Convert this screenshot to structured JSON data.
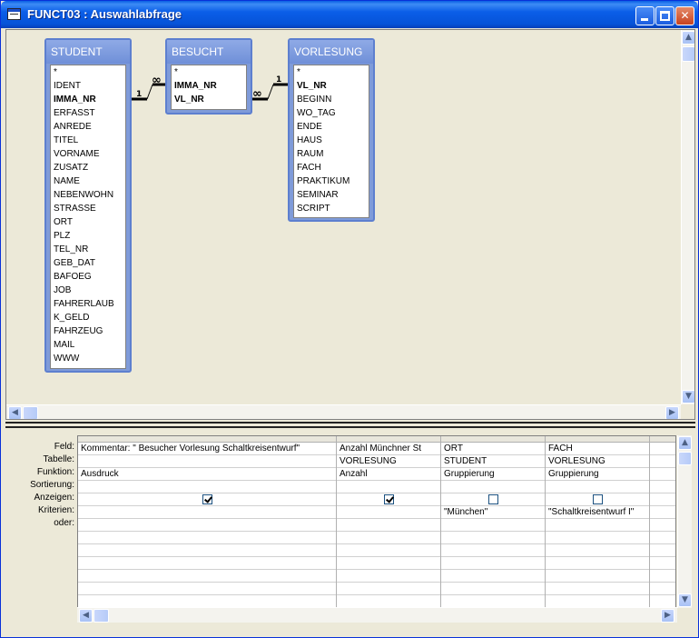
{
  "window": {
    "title": "FUNCT03 : Auswahlabfrage",
    "minimize_label": "",
    "maximize_label": "",
    "close_label": "✕"
  },
  "tables": [
    {
      "name": "STUDENT",
      "fields": [
        {
          "label": "*",
          "key": false
        },
        {
          "label": "IDENT",
          "key": false
        },
        {
          "label": "IMMA_NR",
          "key": true
        },
        {
          "label": "ERFASST",
          "key": false
        },
        {
          "label": "ANREDE",
          "key": false
        },
        {
          "label": "TITEL",
          "key": false
        },
        {
          "label": "VORNAME",
          "key": false
        },
        {
          "label": "ZUSATZ",
          "key": false
        },
        {
          "label": "NAME",
          "key": false
        },
        {
          "label": "NEBENWOHN",
          "key": false
        },
        {
          "label": "STRASSE",
          "key": false
        },
        {
          "label": "ORT",
          "key": false
        },
        {
          "label": "PLZ",
          "key": false
        },
        {
          "label": "TEL_NR",
          "key": false
        },
        {
          "label": "GEB_DAT",
          "key": false
        },
        {
          "label": "BAFOEG",
          "key": false
        },
        {
          "label": "JOB",
          "key": false
        },
        {
          "label": "FAHRERLAUB",
          "key": false
        },
        {
          "label": "K_GELD",
          "key": false
        },
        {
          "label": "FAHRZEUG",
          "key": false
        },
        {
          "label": "MAIL",
          "key": false
        },
        {
          "label": "WWW",
          "key": false
        }
      ]
    },
    {
      "name": "BESUCHT",
      "fields": [
        {
          "label": "*",
          "key": false
        },
        {
          "label": "IMMA_NR",
          "key": true
        },
        {
          "label": "VL_NR",
          "key": true
        }
      ]
    },
    {
      "name": "VORLESUNG",
      "fields": [
        {
          "label": "*",
          "key": false
        },
        {
          "label": "VL_NR",
          "key": true
        },
        {
          "label": "BEGINN",
          "key": false
        },
        {
          "label": "WO_TAG",
          "key": false
        },
        {
          "label": "ENDE",
          "key": false
        },
        {
          "label": "HAUS",
          "key": false
        },
        {
          "label": "RAUM",
          "key": false
        },
        {
          "label": "FACH",
          "key": false
        },
        {
          "label": "PRAKTIKUM",
          "key": false
        },
        {
          "label": "SEMINAR",
          "key": false
        },
        {
          "label": "SCRIPT",
          "key": false
        }
      ]
    }
  ],
  "relations": [
    {
      "one": "1",
      "many": "∞"
    },
    {
      "many": "∞",
      "one": "1"
    }
  ],
  "grid": {
    "row_labels": [
      "Feld:",
      "Tabelle:",
      "Funktion:",
      "Sortierung:",
      "Anzeigen:",
      "Kriterien:",
      "oder:"
    ],
    "columns": [
      {
        "feld": "Kommentar: \" Besucher Vorlesung Schaltkreisentwurf\"",
        "tabelle": "",
        "funktion": "Ausdruck",
        "sortierung": "",
        "anzeigen": true,
        "kriterien": "",
        "oder": ""
      },
      {
        "feld": "Anzahl Münchner St",
        "tabelle": "VORLESUNG",
        "funktion": "Anzahl",
        "sortierung": "",
        "anzeigen": true,
        "kriterien": "",
        "oder": ""
      },
      {
        "feld": "ORT",
        "tabelle": "STUDENT",
        "funktion": "Gruppierung",
        "sortierung": "",
        "anzeigen": false,
        "kriterien": "\"München\"",
        "oder": ""
      },
      {
        "feld": "FACH",
        "tabelle": "VORLESUNG",
        "funktion": "Gruppierung",
        "sortierung": "",
        "anzeigen": false,
        "kriterien": "\"Schaltkreisentwurf I\"",
        "oder": ""
      },
      {
        "feld": "",
        "tabelle": "",
        "funktion": "",
        "sortierung": "",
        "anzeigen": null,
        "kriterien": "",
        "oder": ""
      }
    ]
  },
  "scroll_arrows": {
    "up": "▲",
    "down": "▼",
    "left": "◀",
    "right": "▶"
  }
}
